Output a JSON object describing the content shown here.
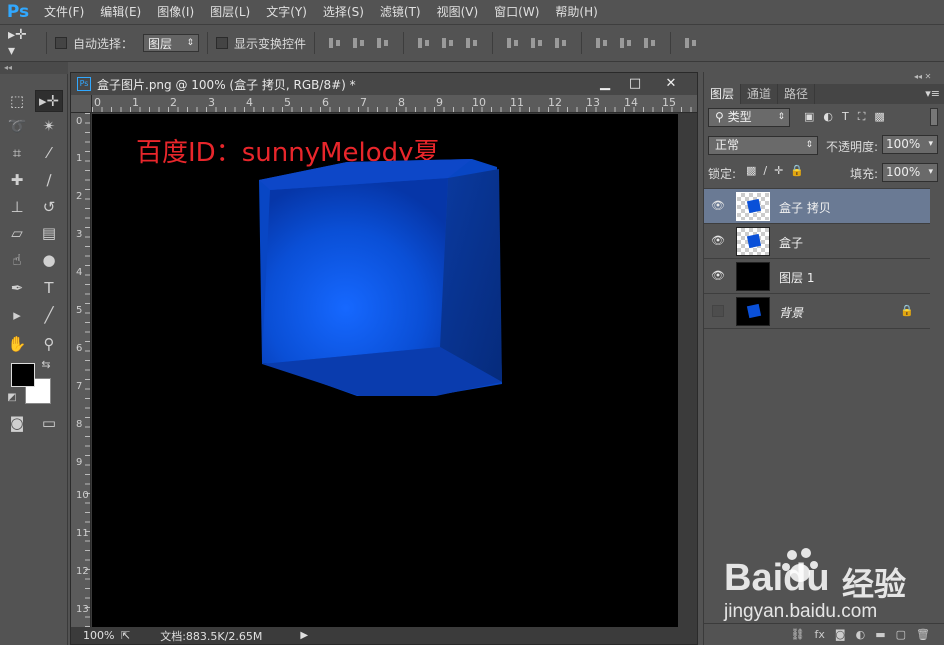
{
  "app": {
    "logo": "Ps"
  },
  "menu": [
    "文件(F)",
    "编辑(E)",
    "图像(I)",
    "图层(L)",
    "文字(Y)",
    "选择(S)",
    "滤镜(T)",
    "视图(V)",
    "窗口(W)",
    "帮助(H)"
  ],
  "options": {
    "auto_select_label": "自动选择：",
    "auto_select_value": "图层",
    "show_transform_label": "显示变换控件"
  },
  "document": {
    "title": "盒子图片.png @ 100% (盒子 拷贝, RGB/8#) *",
    "watermark": "百度ID：sunnyMelody夏",
    "ruler_top": [
      "0",
      "1",
      "2",
      "3",
      "4",
      "5",
      "6",
      "7",
      "8",
      "9",
      "10",
      "11",
      "12",
      "13",
      "14",
      "15"
    ],
    "ruler_left": [
      "0",
      "1",
      "2",
      "3",
      "4",
      "5",
      "6",
      "7",
      "8",
      "9",
      "10",
      "11",
      "12",
      "13"
    ],
    "status": {
      "zoom": "100%",
      "doc_size": "文档:883.5K/2.65M"
    }
  },
  "layers_panel": {
    "tabs": [
      "图层",
      "通道",
      "路径"
    ],
    "filter_kind": "类型",
    "blend_mode": "正常",
    "opacity_label": "不透明度:",
    "opacity_value": "100%",
    "lock_label": "锁定:",
    "fill_label": "填充:",
    "fill_value": "100%",
    "layers": [
      {
        "name": "盒子 拷贝",
        "visible": true,
        "selected": true
      },
      {
        "name": "盒子",
        "visible": true,
        "selected": false
      },
      {
        "name": "图层 1",
        "visible": true,
        "selected": false
      },
      {
        "name": "背景",
        "visible": false,
        "selected": false,
        "locked": true
      }
    ]
  },
  "baidu": {
    "brand": "Baidu",
    "brand_cn": "经验",
    "url": "jingyan.baidu.com"
  },
  "colors": {
    "accent_ps": "#31a8ff",
    "cube_blue": "#0a50d8",
    "watermark_red": "#e8262b",
    "selected_layer": "#6a7a94"
  }
}
